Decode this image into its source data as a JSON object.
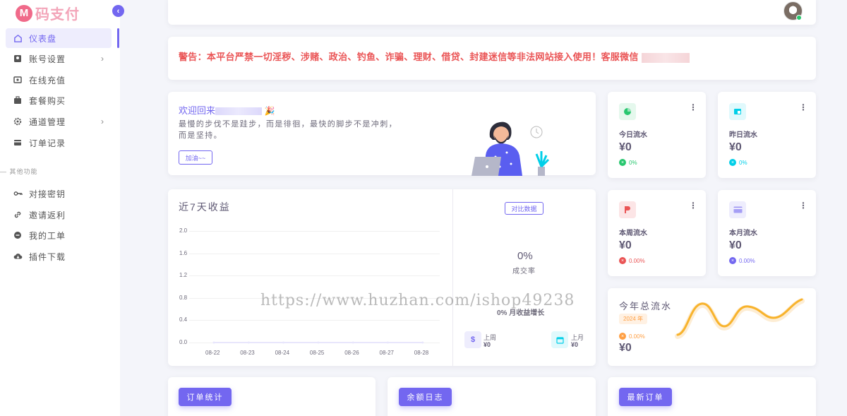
{
  "app": {
    "logo_letter": "M",
    "name": "码支付"
  },
  "sidebar": {
    "items": [
      {
        "label": "仪表盘"
      },
      {
        "label": "账号设置"
      },
      {
        "label": "在线充值"
      },
      {
        "label": "套餐购买"
      },
      {
        "label": "通道管理"
      },
      {
        "label": "订单记录"
      }
    ],
    "section_title": "其他功能",
    "other_items": [
      {
        "label": "对接密钥"
      },
      {
        "label": "邀请返利"
      },
      {
        "label": "我的工单"
      },
      {
        "label": "插件下载"
      }
    ]
  },
  "notice": {
    "text": "警告：本平台严禁一切淫秽、涉赌、政治、钓鱼、诈骗、理财、借贷、封建迷信等非法网站接入使用！客服微信"
  },
  "welcome": {
    "title": "欢迎回来",
    "line1": "最慢的步伐不是跬步，而是徘徊，最快的脚步不是冲刺，",
    "line2": "而是坚持。",
    "button": "加油~~"
  },
  "stats": {
    "today": {
      "label": "今日流水",
      "value": "¥0",
      "change": "0%"
    },
    "yesterday": {
      "label": "昨日流水",
      "value": "¥0",
      "change": "0%"
    },
    "week": {
      "label": "本周流水",
      "value": "¥0",
      "change": "0.00%"
    },
    "month": {
      "label": "本月流水",
      "value": "¥0",
      "change": "0.00%"
    },
    "year": {
      "label": "今年总流水",
      "badge": "2024 年",
      "change": "0.00%",
      "value": "¥0"
    }
  },
  "chart": {
    "title": "近7天收益",
    "compare_button": "对比数据",
    "rate_value": "0%",
    "rate_label": "成交率",
    "growth_label": "0% 月收益增长",
    "last_week_label": "上周",
    "last_week_value": "¥0",
    "last_month_label": "上月",
    "last_month_value": "¥0"
  },
  "chart_data": {
    "type": "line",
    "title": "近7天收益",
    "categories": [
      "08-22",
      "08-23",
      "08-24",
      "08-25",
      "08-26",
      "08-27",
      "08-28"
    ],
    "values": [
      0,
      0,
      0,
      0,
      0,
      0,
      0
    ],
    "yticks": [
      "2.0",
      "1.6",
      "1.2",
      "0.8",
      "0.4",
      "0.0"
    ],
    "ylim": [
      0,
      2.0
    ]
  },
  "watermark": "https://www.huzhan.com/ishop49238",
  "bottom_buttons": {
    "orders": "订单统计",
    "balance": "余额日志",
    "latest": "最新订单"
  },
  "colors": {
    "primary": "#7367f0",
    "danger": "#ea5455",
    "success": "#28c76f",
    "info": "#00cfe8",
    "warning": "#ff9f43"
  }
}
